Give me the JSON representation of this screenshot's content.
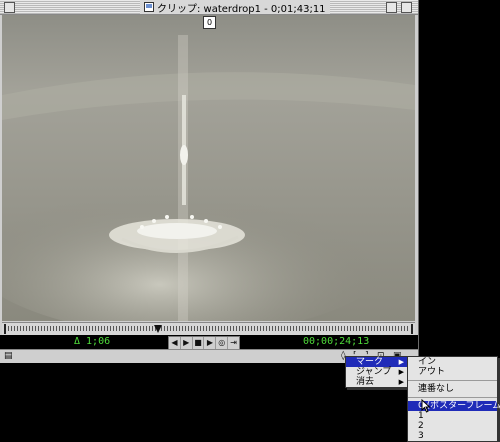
{
  "window": {
    "title": "クリップ: waterdrop1 - 0;01;43;11"
  },
  "video": {
    "poster_marker": "0"
  },
  "controls": {
    "delta_timecode": "Δ 1;06",
    "current_timecode": "00;00;24;13",
    "transport_icons": [
      "step-back-icon",
      "step-forward-icon",
      "stop-icon",
      "play-icon",
      "loop-icon",
      "play-in-out-icon"
    ],
    "transport_glyphs": [
      "◀",
      "▶",
      "■",
      "▶",
      "◎",
      "⇥"
    ]
  },
  "context_menu": {
    "items": [
      {
        "label": "マーク",
        "has_submenu": true,
        "highlighted": true
      },
      {
        "label": "ジャンプ",
        "has_submenu": true,
        "highlighted": false
      },
      {
        "label": "消去",
        "has_submenu": true,
        "highlighted": false
      }
    ]
  },
  "mark_submenu": {
    "items": [
      "イン",
      "アウト",
      "連番なし",
      "0 (ポスターフレーム)",
      "1",
      "2",
      "3"
    ],
    "highlighted_index": 3
  },
  "colors": {
    "timecode_green": "#4fdc3a",
    "menu_highlight": "#1f2bb8"
  }
}
